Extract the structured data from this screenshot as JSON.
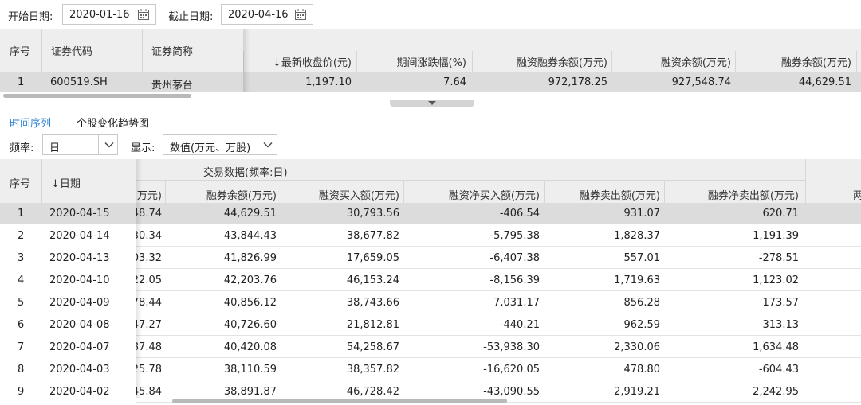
{
  "filter": {
    "start_label": "开始日期:",
    "start_date": "2020-01-16",
    "end_label": "截止日期:",
    "end_date": "2020-04-16"
  },
  "summary": {
    "headers": [
      "序号",
      "证券代码",
      "证券简称",
      "↓最新收盘价(元)",
      "期间涨跌幅(%)",
      "融资融券余额(万元)",
      "融资余额(万元)",
      "融券余额(万元)"
    ],
    "row": [
      "1",
      "600519.SH",
      "贵州茅台",
      "1,197.10",
      "7.64",
      "972,178.25",
      "927,548.74",
      "44,629.51"
    ]
  },
  "tabs": [
    "时间序列",
    "个股变化趋势图"
  ],
  "controls": {
    "freq_label": "频率:",
    "freq_value": "日",
    "display_label": "显示:",
    "display_value": "数值(万元、万股)"
  },
  "table": {
    "group_header": "交易数据(频率:日)",
    "headers": [
      "序号",
      "↓日期",
      "万元)",
      "融券余额(万元)",
      "融资买入额(万元)",
      "融资净买入额(万元)",
      "融券卖出额(万元)",
      "融券净卖出额(万元)",
      "两"
    ],
    "rows": [
      [
        "1",
        "2020-04-15",
        "48.74",
        "44,629.51",
        "30,793.56",
        "-406.54",
        "931.07",
        "620.71"
      ],
      [
        "2",
        "2020-04-14",
        "30.34",
        "43,844.43",
        "38,677.82",
        "-5,795.38",
        "1,828.37",
        "1,191.39"
      ],
      [
        "3",
        "2020-04-13",
        "03.32",
        "41,826.99",
        "17,659.05",
        "-6,407.38",
        "557.01",
        "-278.51"
      ],
      [
        "4",
        "2020-04-10",
        "22.05",
        "42,203.76",
        "46,153.24",
        "-8,156.39",
        "1,719.63",
        "1,123.02"
      ],
      [
        "5",
        "2020-04-09",
        "78.44",
        "40,856.12",
        "38,743.66",
        "7,031.17",
        "856.28",
        "173.57"
      ],
      [
        "6",
        "2020-04-08",
        "47.27",
        "40,726.60",
        "21,812.81",
        "-440.21",
        "962.59",
        "313.13"
      ],
      [
        "7",
        "2020-04-07",
        "87.48",
        "40,420.08",
        "54,258.67",
        "-53,938.30",
        "2,330.06",
        "1,634.48"
      ],
      [
        "8",
        "2020-04-03",
        "25.78",
        "38,110.59",
        "38,357.82",
        "-16,620.05",
        "478.80",
        "-604.43"
      ],
      [
        "9",
        "2020-04-02",
        "45.84",
        "38,891.87",
        "46,728.42",
        "-43,090.55",
        "2,919.21",
        "2,242.95"
      ]
    ]
  },
  "icons": {
    "calendar": "calendar-icon",
    "dropdown": "chevron-down-icon"
  },
  "colors": {
    "accent": "#2f86d6",
    "header_bg": "#eeeeee",
    "selected_row": "#dcdcdc"
  }
}
